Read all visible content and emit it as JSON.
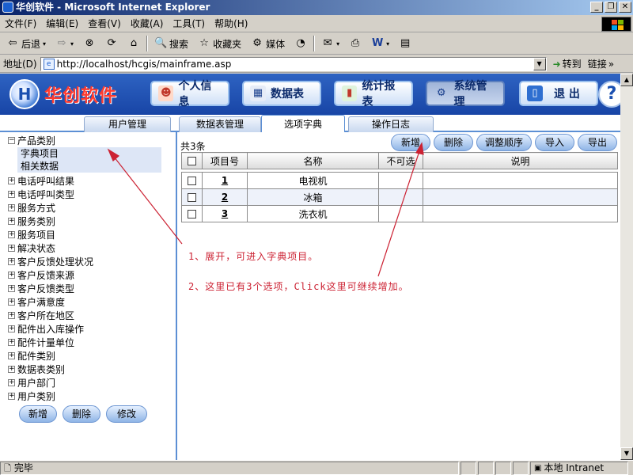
{
  "window": {
    "title": "华创软件 - Microsoft Internet Explorer"
  },
  "menubar": {
    "items": [
      "文件(F)",
      "编辑(E)",
      "查看(V)",
      "收藏(A)",
      "工具(T)",
      "帮助(H)"
    ]
  },
  "toolbar": {
    "back": "后退",
    "search": "搜索",
    "favorites": "收藏夹",
    "media": "媒体"
  },
  "address": {
    "label": "地址(D)",
    "url": "http://localhost/hcgis/mainframe.asp",
    "go": "转到",
    "links": "链接"
  },
  "app": {
    "brand": "华创软件",
    "nav": [
      {
        "label": "个人信息",
        "icon": "person-icon"
      },
      {
        "label": "数据表",
        "icon": "table-icon"
      },
      {
        "label": "统计报表",
        "icon": "report-icon"
      },
      {
        "label": "系统管理",
        "icon": "gear-icon"
      },
      {
        "label": "退 出",
        "icon": "exit-icon"
      }
    ],
    "help": "?"
  },
  "tabs": [
    "用户管理",
    "数据表管理",
    "选项字典",
    "操作日志"
  ],
  "active_tab": "选项字典",
  "tree": {
    "expanded": {
      "label": "产品类别",
      "toggle": "⊟",
      "children": [
        "字典项目",
        "相关数据"
      ]
    },
    "items": [
      "电话呼叫结果",
      "电话呼叫类型",
      "服务方式",
      "服务类别",
      "服务项目",
      "解决状态",
      "客户反馈处理状况",
      "客户反馈来源",
      "客户反馈类型",
      "客户满意度",
      "客户所在地区",
      "配件出入库操作",
      "配件计量单位",
      "配件类别",
      "数据表类别",
      "用户部门",
      "用户类别"
    ],
    "collapsed_toggle": "⊞"
  },
  "left_buttons": [
    "新增",
    "删除",
    "修改"
  ],
  "right": {
    "count": "共3条",
    "buttons": [
      "新增",
      "删除",
      "调整顺序",
      "导入",
      "导出"
    ],
    "columns": [
      "",
      "项目号",
      "名称",
      "不可选",
      "说明"
    ],
    "rows": [
      {
        "id": "1",
        "name": "电视机",
        "disabled": "",
        "note": ""
      },
      {
        "id": "2",
        "name": "冰箱",
        "disabled": "",
        "note": ""
      },
      {
        "id": "3",
        "name": "洗衣机",
        "disabled": "",
        "note": ""
      }
    ]
  },
  "annotations": [
    "1、展开，可进入字典项目。",
    "2、这里已有3个选项，Click这里可继续增加。"
  ],
  "annotation_color": "#cc2233",
  "statusbar": {
    "status": "完毕",
    "zone": "本地 Intranet"
  }
}
